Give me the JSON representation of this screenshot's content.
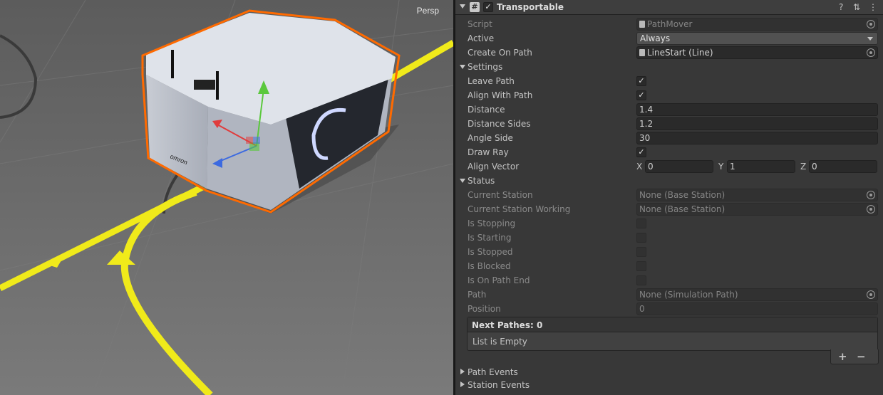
{
  "scene": {
    "view_label": "Persp",
    "robot_logo": "omron"
  },
  "inspector": {
    "component_title": "Transportable",
    "component_enabled": true,
    "fields": {
      "script": {
        "label": "Script",
        "value": "PathMover"
      },
      "active": {
        "label": "Active",
        "value": "Always"
      },
      "create_on_path": {
        "label": "Create On Path",
        "value": "LineStart (Line)"
      }
    },
    "settings": {
      "header": "Settings",
      "leave_path": {
        "label": "Leave Path",
        "checked": true
      },
      "align_with_path": {
        "label": "Align With Path",
        "checked": true
      },
      "distance": {
        "label": "Distance",
        "value": "1.4"
      },
      "distance_sides": {
        "label": "Distance Sides",
        "value": "1.2"
      },
      "angle_side": {
        "label": "Angle Side",
        "value": "30"
      },
      "draw_ray": {
        "label": "Draw Ray",
        "checked": true
      },
      "align_vector": {
        "label": "Align Vector",
        "x_label": "X",
        "x": "0",
        "y_label": "Y",
        "y": "1",
        "z_label": "Z",
        "z": "0"
      }
    },
    "status": {
      "header": "Status",
      "current_station": {
        "label": "Current Station",
        "value": "None (Base Station)"
      },
      "current_station_working": {
        "label": "Current Station Working",
        "value": "None (Base Station)"
      },
      "is_stopping": {
        "label": "Is Stopping",
        "checked": false
      },
      "is_starting": {
        "label": "Is Starting",
        "checked": false
      },
      "is_stopped": {
        "label": "Is Stopped",
        "checked": false
      },
      "is_blocked": {
        "label": "Is Blocked",
        "checked": false
      },
      "is_on_path_end": {
        "label": "Is On Path End",
        "checked": false
      },
      "path": {
        "label": "Path",
        "value": "None (Simulation Path)"
      },
      "position": {
        "label": "Position",
        "value": "0"
      }
    },
    "next_pathes": {
      "header": "Next Pathes: 0",
      "empty_text": "List is Empty",
      "add": "+",
      "remove": "−"
    },
    "path_events": "Path Events",
    "station_events": "Station Events"
  }
}
